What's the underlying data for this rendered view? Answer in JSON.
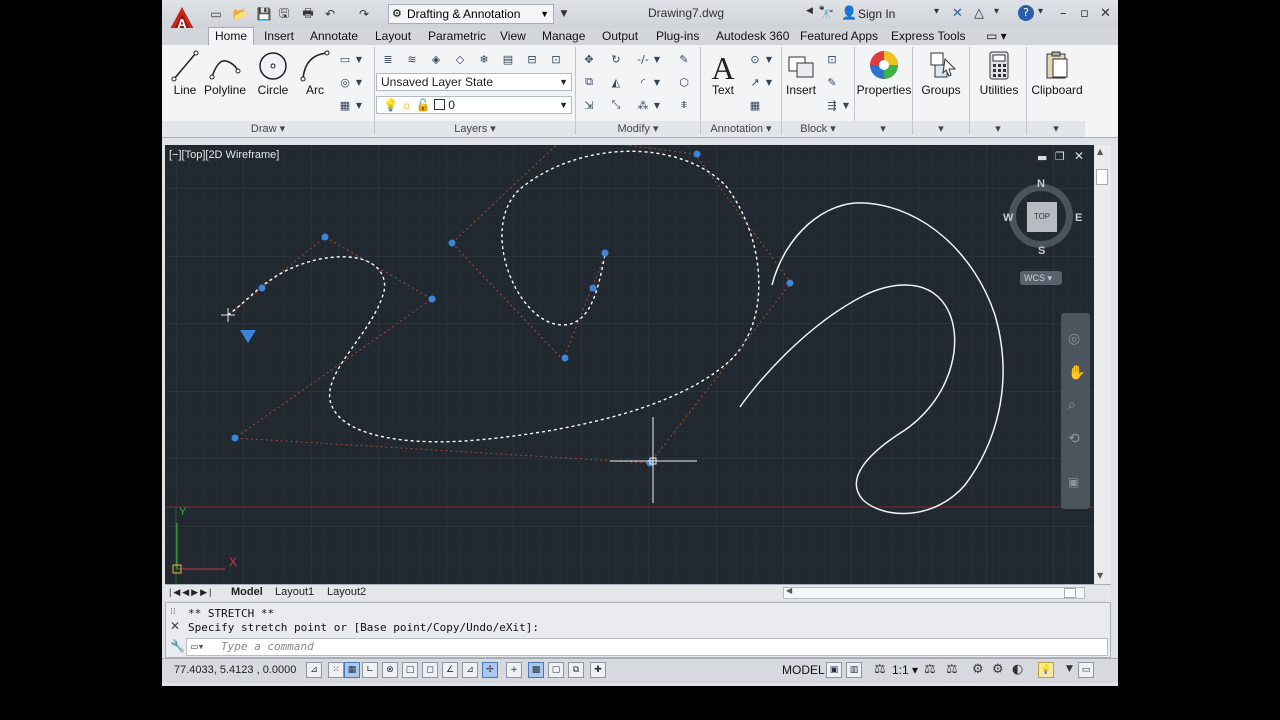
{
  "title_bar": {
    "workspace": "Drafting & Annotation",
    "document_title": "Drawing7.dwg",
    "sign_in": "Sign In"
  },
  "tabs": [
    "Home",
    "Insert",
    "Annotate",
    "Layout",
    "Parametric",
    "View",
    "Manage",
    "Output",
    "Plug-ins",
    "Autodesk 360",
    "Featured Apps",
    "Express Tools"
  ],
  "active_tab": "Home",
  "ribbon": {
    "draw": {
      "title": "Draw ▾",
      "line": "Line",
      "polyline": "Polyline",
      "circle": "Circle",
      "arc": "Arc"
    },
    "layers": {
      "title": "Layers ▾",
      "layer_state": "Unsaved Layer State",
      "current_layer": "0"
    },
    "modify": {
      "title": "Modify ▾"
    },
    "annotation": {
      "title": "Annotation ▾",
      "text": "Text"
    },
    "block": {
      "title": "Block ▾",
      "insert": "Insert"
    },
    "properties": "Properties",
    "groups": "Groups",
    "utilities": "Utilities",
    "clipboard": "Clipboard"
  },
  "viewport": {
    "label": "[−][Top][2D Wireframe]",
    "viewcube": {
      "n": "N",
      "s": "S",
      "e": "E",
      "w": "W",
      "top": "TOP",
      "ucs": "WCS"
    },
    "axis_x": "X",
    "axis_y": "Y"
  },
  "layout_tabs": [
    "Model",
    "Layout1",
    "Layout2"
  ],
  "command": {
    "line1": "** STRETCH **",
    "line2": "Specify stretch point or [Base point/Copy/Undo/eXit]:",
    "placeholder": "Type a command"
  },
  "status_bar": {
    "coordinates": "77.4033, 5.4123 , 0.0000",
    "space": "MODEL",
    "scale": "1:1 ▾"
  },
  "colors": {
    "accent": "#3b7fd9",
    "canvas": "#212830",
    "grip": "#3e85d8"
  }
}
